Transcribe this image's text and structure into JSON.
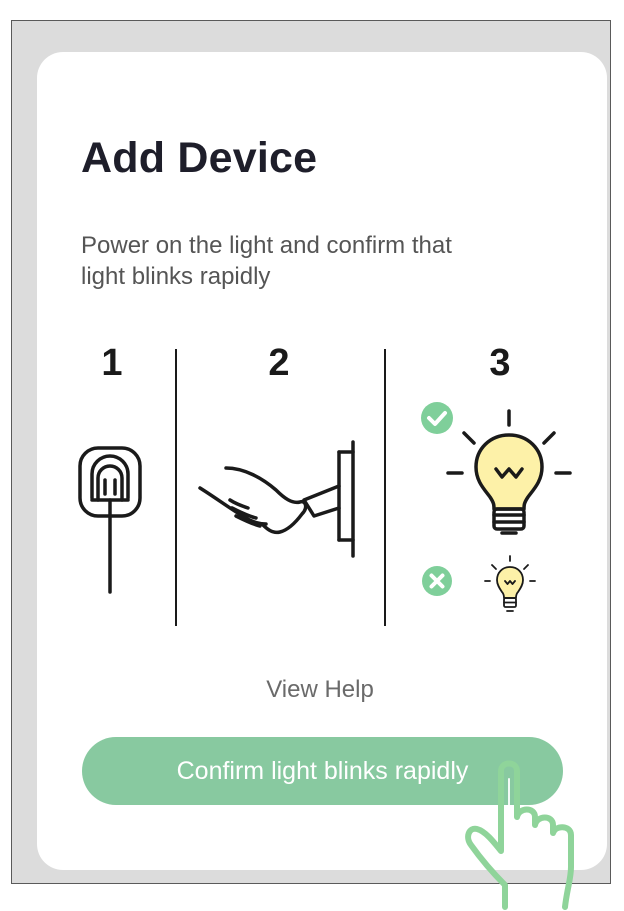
{
  "dialog": {
    "title": "Add Device",
    "description": "Power on the light and confirm that light blinks rapidly"
  },
  "steps": [
    {
      "number": "1",
      "icon": "power-plug-socket-icon"
    },
    {
      "number": "2",
      "icon": "hand-pressing-switch-icon"
    },
    {
      "number": "3",
      "icon": "light-bulb-blinking-icon"
    }
  ],
  "step3_states": {
    "correct_icon": "check-circle-icon",
    "wrong_icon": "x-circle-icon"
  },
  "help_link": {
    "label": "View Help"
  },
  "confirm_button": {
    "label": "Confirm light blinks rapidly"
  },
  "pointer_icon": "pointing-hand-icon",
  "colors": {
    "accent_green": "#88c9a0",
    "check_green": "#7fcf9a",
    "bulb_fill": "#fdf1a8",
    "frame_gray": "#dcdcdc",
    "title_color": "#1e1e2a",
    "text_gray": "#555555"
  }
}
